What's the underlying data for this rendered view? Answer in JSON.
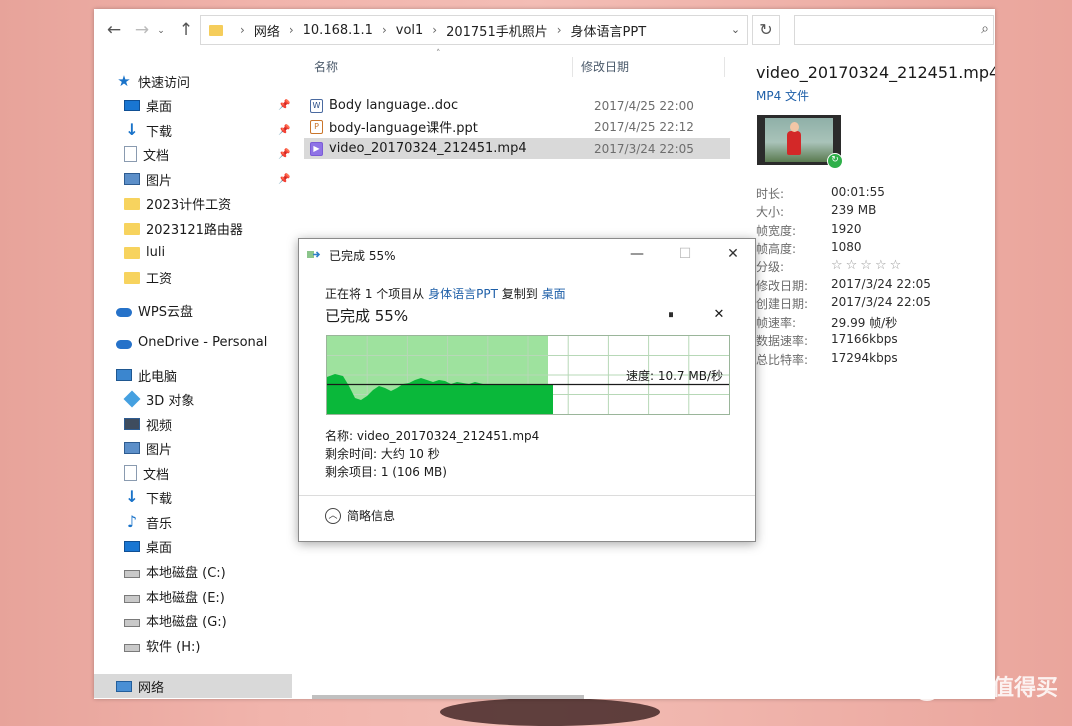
{
  "window": {
    "nav": {
      "back": "←",
      "forward": "→",
      "up": "↑"
    },
    "breadcrumb": [
      "网络",
      "10.168.1.1",
      "vol1",
      "201751手机照片",
      "身体语言PPT"
    ],
    "address_dropdown": "⌄",
    "refresh": "↻",
    "search": {
      "placeholder": "",
      "icon": "search-icon"
    }
  },
  "sidebar": {
    "items": [
      {
        "label": "快速访问",
        "icon": "star-icon",
        "pinned": false
      },
      {
        "label": "桌面",
        "icon": "desktop-icon",
        "pinned": true
      },
      {
        "label": "下载",
        "icon": "download-icon",
        "pinned": true
      },
      {
        "label": "文档",
        "icon": "document-icon",
        "pinned": true
      },
      {
        "label": "图片",
        "icon": "pictures-icon",
        "pinned": true
      },
      {
        "label": "2023计件工资",
        "icon": "folder-icon",
        "pinned": false
      },
      {
        "label": "2023121路由器",
        "icon": "folder-icon",
        "pinned": false
      },
      {
        "label": "luli",
        "icon": "folder-icon",
        "pinned": false
      },
      {
        "label": "工资",
        "icon": "folder-icon",
        "pinned": false
      },
      {
        "label": "WPS云盘",
        "icon": "cloud-icon",
        "pinned": false
      },
      {
        "label": "OneDrive - Personal",
        "icon": "onedrive-icon",
        "pinned": false
      },
      {
        "label": "此电脑",
        "icon": "pc-icon",
        "pinned": false
      },
      {
        "label": "3D 对象",
        "icon": "cube-icon",
        "pinned": false
      },
      {
        "label": "视频",
        "icon": "video-icon",
        "pinned": false
      },
      {
        "label": "图片",
        "icon": "pictures-icon",
        "pinned": false
      },
      {
        "label": "文档",
        "icon": "document-icon",
        "pinned": false
      },
      {
        "label": "下载",
        "icon": "download-icon",
        "pinned": false
      },
      {
        "label": "音乐",
        "icon": "music-icon",
        "pinned": false
      },
      {
        "label": "桌面",
        "icon": "desktop-icon",
        "pinned": false
      },
      {
        "label": "本地磁盘 (C:)",
        "icon": "drive-icon",
        "pinned": false
      },
      {
        "label": "本地磁盘 (E:)",
        "icon": "drive-icon",
        "pinned": false
      },
      {
        "label": "本地磁盘 (G:)",
        "icon": "drive-icon",
        "pinned": false
      },
      {
        "label": "软件 (H:)",
        "icon": "drive-icon",
        "pinned": false
      },
      {
        "label": "网络",
        "icon": "network-icon",
        "pinned": false
      }
    ]
  },
  "filelist": {
    "headers": {
      "name": "名称",
      "modified": "修改日期"
    },
    "rows": [
      {
        "name": "Body language..doc",
        "modified": "2017/4/25 22:00",
        "icon": "word-file-icon"
      },
      {
        "name": "body-language课件.ppt",
        "modified": "2017/4/25 22:12",
        "icon": "ppt-file-icon"
      },
      {
        "name": "video_20170324_212451.mp4",
        "modified": "2017/3/24 22:05",
        "icon": "video-file-icon"
      }
    ]
  },
  "details": {
    "filename": "video_20170324_212451.mp4",
    "filetype": "MP4 文件",
    "props": [
      {
        "label": "时长:",
        "value": "00:01:55"
      },
      {
        "label": "大小:",
        "value": "239 MB"
      },
      {
        "label": "帧宽度:",
        "value": "1920"
      },
      {
        "label": "帧高度:",
        "value": "1080"
      },
      {
        "label": "分级:",
        "value": "☆☆☆☆☆"
      },
      {
        "label": "修改日期:",
        "value": "2017/3/24 22:05"
      },
      {
        "label": "创建日期:",
        "value": "2017/3/24 22:05"
      },
      {
        "label": "帧速率:",
        "value": "29.99 帧/秒"
      },
      {
        "label": "数据速率:",
        "value": "17166kbps"
      },
      {
        "label": "总比特率:",
        "value": "17294kbps"
      }
    ],
    "rating": 0
  },
  "dialog": {
    "title": "已完成 55%",
    "minimize": "—",
    "maximize": "☐",
    "close": "✕",
    "copying_prefix": "正在将 1 个项目从",
    "source": "身体语言PPT",
    "copying_mid": "复制到",
    "destination": "桌面",
    "progress_text": "已完成 55%",
    "progress": 0.55,
    "pause": "⏸",
    "cancel": "✕",
    "speed": "速度: 10.7 MB/秒",
    "name_line": "名称: video_20170324_212451.mp4",
    "time_left": "剩余时间: 大约 10 秒",
    "items_left": "剩余项目: 1 (106 MB)",
    "more_toggle": "简略信息",
    "colors": {
      "fill": "#9ee29e",
      "area": "#0ab83a",
      "grid": "#b7d8b7"
    }
  },
  "watermark": {
    "text": "什么值得买",
    "logo": "值"
  }
}
